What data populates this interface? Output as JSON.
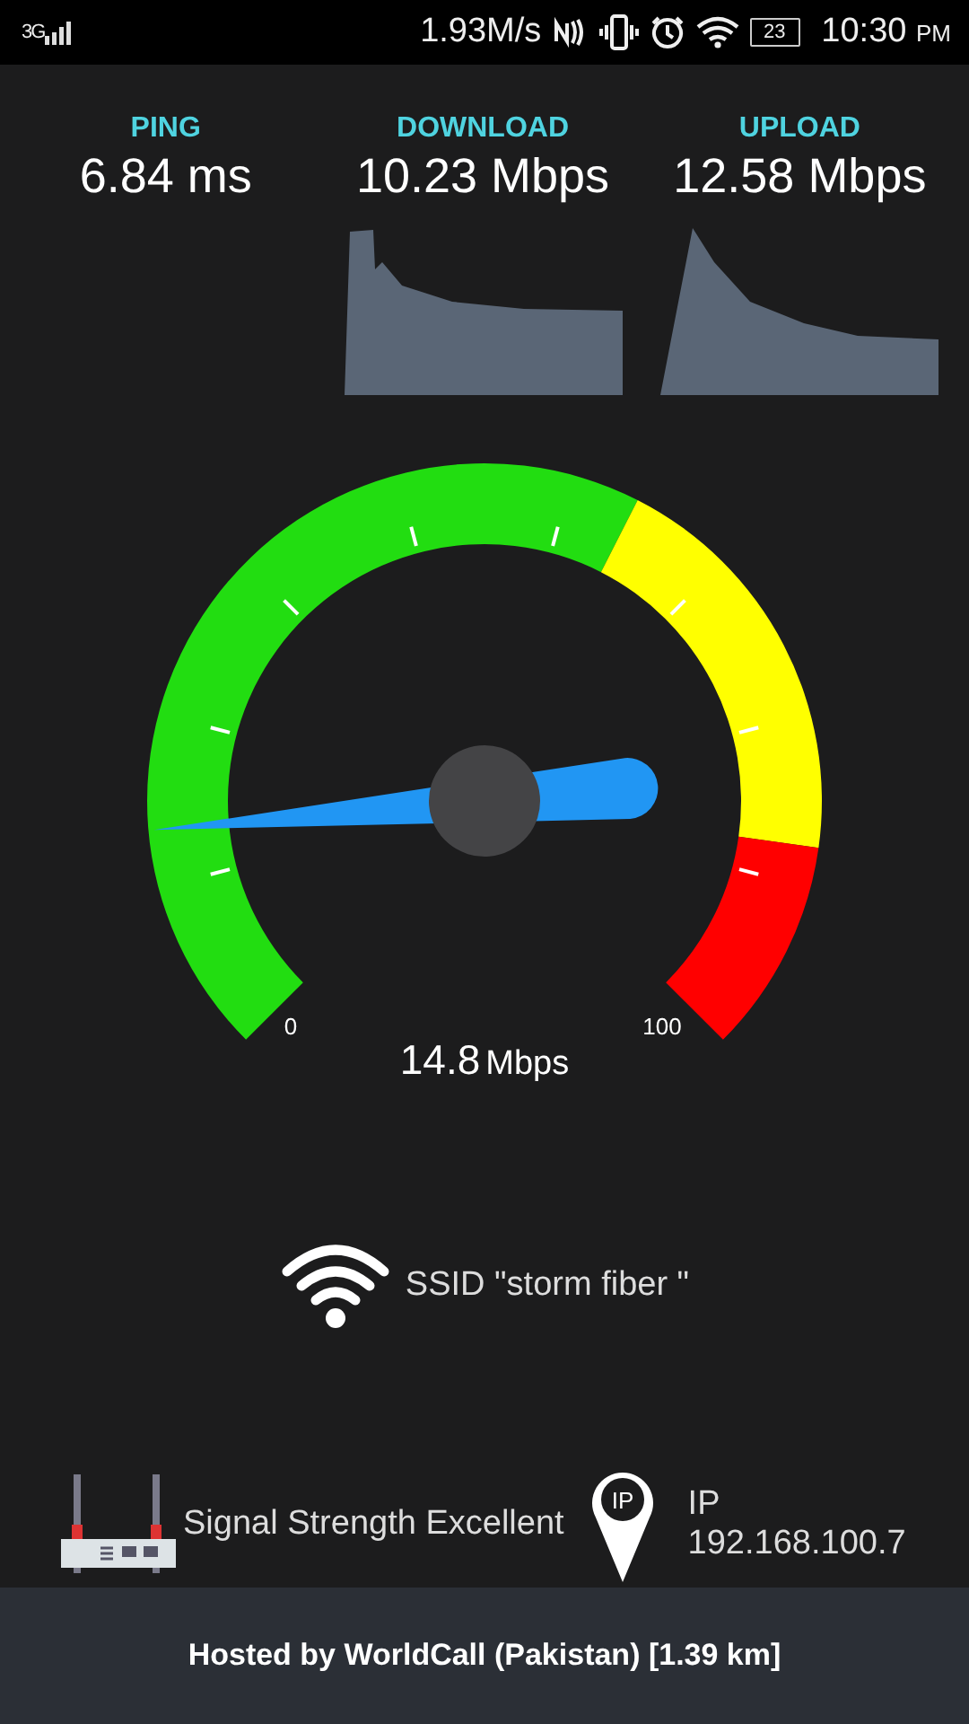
{
  "status_bar": {
    "network": "3G",
    "speed": "1.93M/s",
    "battery": "23",
    "time": "10:30",
    "ampm": "PM"
  },
  "metrics": [
    {
      "label": "PING",
      "value": "6.84 ms",
      "kind": "plain"
    },
    {
      "label": "DOWNLOAD",
      "value": "10.23 Mbps",
      "kind": "plateau"
    },
    {
      "label": "UPLOAD",
      "value": "12.58 Mbps",
      "kind": "peak"
    }
  ],
  "gauge": {
    "min_label": "0",
    "max_label": "100",
    "reading": "14.8",
    "unit": "Mbps"
  },
  "ssid": "SSID \"storm fiber \"",
  "signal": "Signal Strength Excellent",
  "ip": {
    "badge": "IP",
    "label": "IP",
    "address": "192.168.100.7"
  },
  "footer": "Hosted by WorldCall (Pakistan) [1.39 km]"
}
